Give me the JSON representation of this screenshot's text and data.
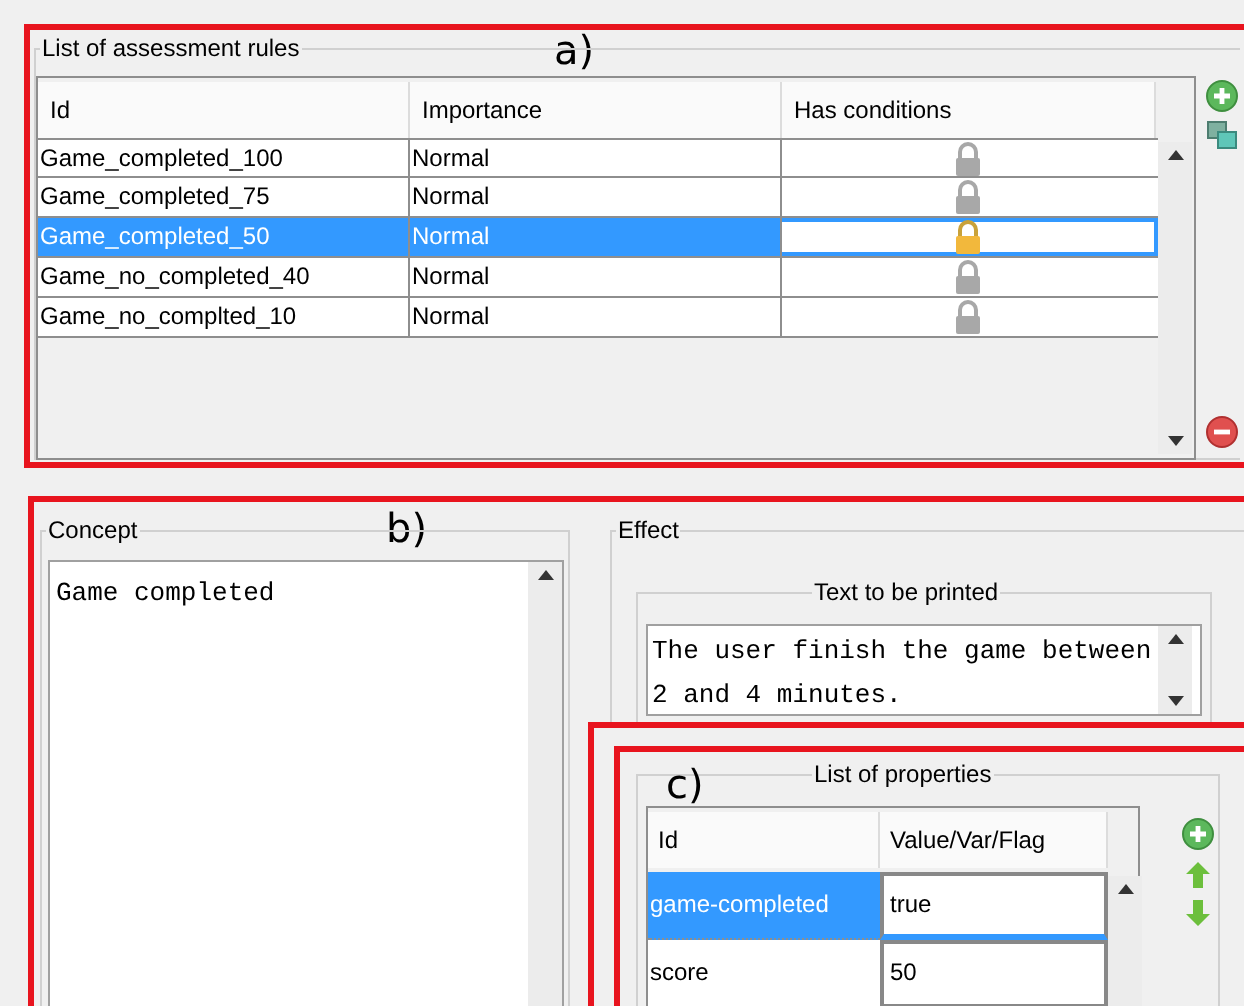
{
  "annotations": {
    "a": "a)",
    "b": "b)",
    "c": "c)"
  },
  "rules": {
    "title": "List of assessment rules",
    "columns": [
      "Id",
      "Importance",
      "Has conditions"
    ],
    "rows": [
      {
        "id": "Game_completed_100",
        "importance": "Normal",
        "selected": false
      },
      {
        "id": "Game_completed_75",
        "importance": "Normal",
        "selected": false
      },
      {
        "id": "Game_completed_50",
        "importance": "Normal",
        "selected": true
      },
      {
        "id": "Game_no_completed_40",
        "importance": "Normal",
        "selected": false
      },
      {
        "id": "Game_no_complted_10",
        "importance": "Normal",
        "selected": false
      }
    ]
  },
  "concept": {
    "title": "Concept",
    "value": "Game completed"
  },
  "effect": {
    "title": "Effect",
    "text_group": "Text to be printed",
    "text_value": "The user finish the game between 2 and 4 minutes.",
    "properties": {
      "title": "List of properties",
      "columns": [
        "Id",
        "Value/Var/Flag"
      ],
      "rows": [
        {
          "id": "game-completed",
          "value": "true",
          "selected": true
        },
        {
          "id": "score",
          "value": "50",
          "selected": false
        }
      ]
    }
  }
}
